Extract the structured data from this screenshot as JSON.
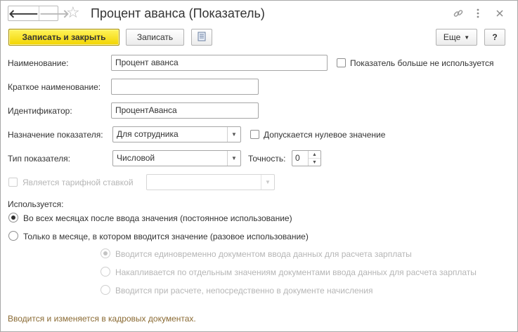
{
  "window": {
    "title": "Процент аванса (Показатель)",
    "nav_back": "🡐",
    "nav_forward": "🡒",
    "star_icon": "star-icon",
    "link_icon": "link-icon",
    "more_icon": "more-vertical-icon",
    "close_icon": "close-icon"
  },
  "toolbar": {
    "save_close_label": "Записать и закрыть",
    "save_label": "Записать",
    "more_label": "Еще",
    "help_label": "?"
  },
  "form": {
    "name": {
      "label": "Наименование:",
      "value": "Процент аванса"
    },
    "unused_checkbox": {
      "label": "Показатель больше не используется",
      "checked": false
    },
    "short_name": {
      "label": "Краткое наименование:",
      "value": ""
    },
    "identifier": {
      "label": "Идентификатор:",
      "value": "ПроцентАванса"
    },
    "purpose": {
      "label": "Назначение показателя:",
      "value": "Для сотрудника"
    },
    "zero_allowed": {
      "label": "Допускается нулевое значение",
      "checked": false
    },
    "type": {
      "label": "Тип показателя:",
      "value": "Числовой"
    },
    "precision": {
      "label": "Точность:",
      "value": "0"
    },
    "tariff_rate": {
      "label": "Является тарифной ставкой",
      "checked": false,
      "value": ""
    },
    "usage": {
      "label": "Используется:",
      "options": [
        {
          "label": "Во всех месяцах после ввода значения (постоянное использование)",
          "selected": true
        },
        {
          "label": "Только в месяце, в котором вводится значение (разовое использование)",
          "selected": false
        }
      ],
      "sub_options": [
        {
          "label": "Вводится единовременно документом ввода данных для расчета зарплаты",
          "selected": true
        },
        {
          "label": "Накапливается по отдельным значениям документами ввода данных для расчета зарплаты",
          "selected": false
        },
        {
          "label": "Вводится при расчете, непосредственно в документе начисления",
          "selected": false
        }
      ]
    }
  },
  "footer": {
    "note": "Вводится и изменяется в кадровых документах."
  }
}
